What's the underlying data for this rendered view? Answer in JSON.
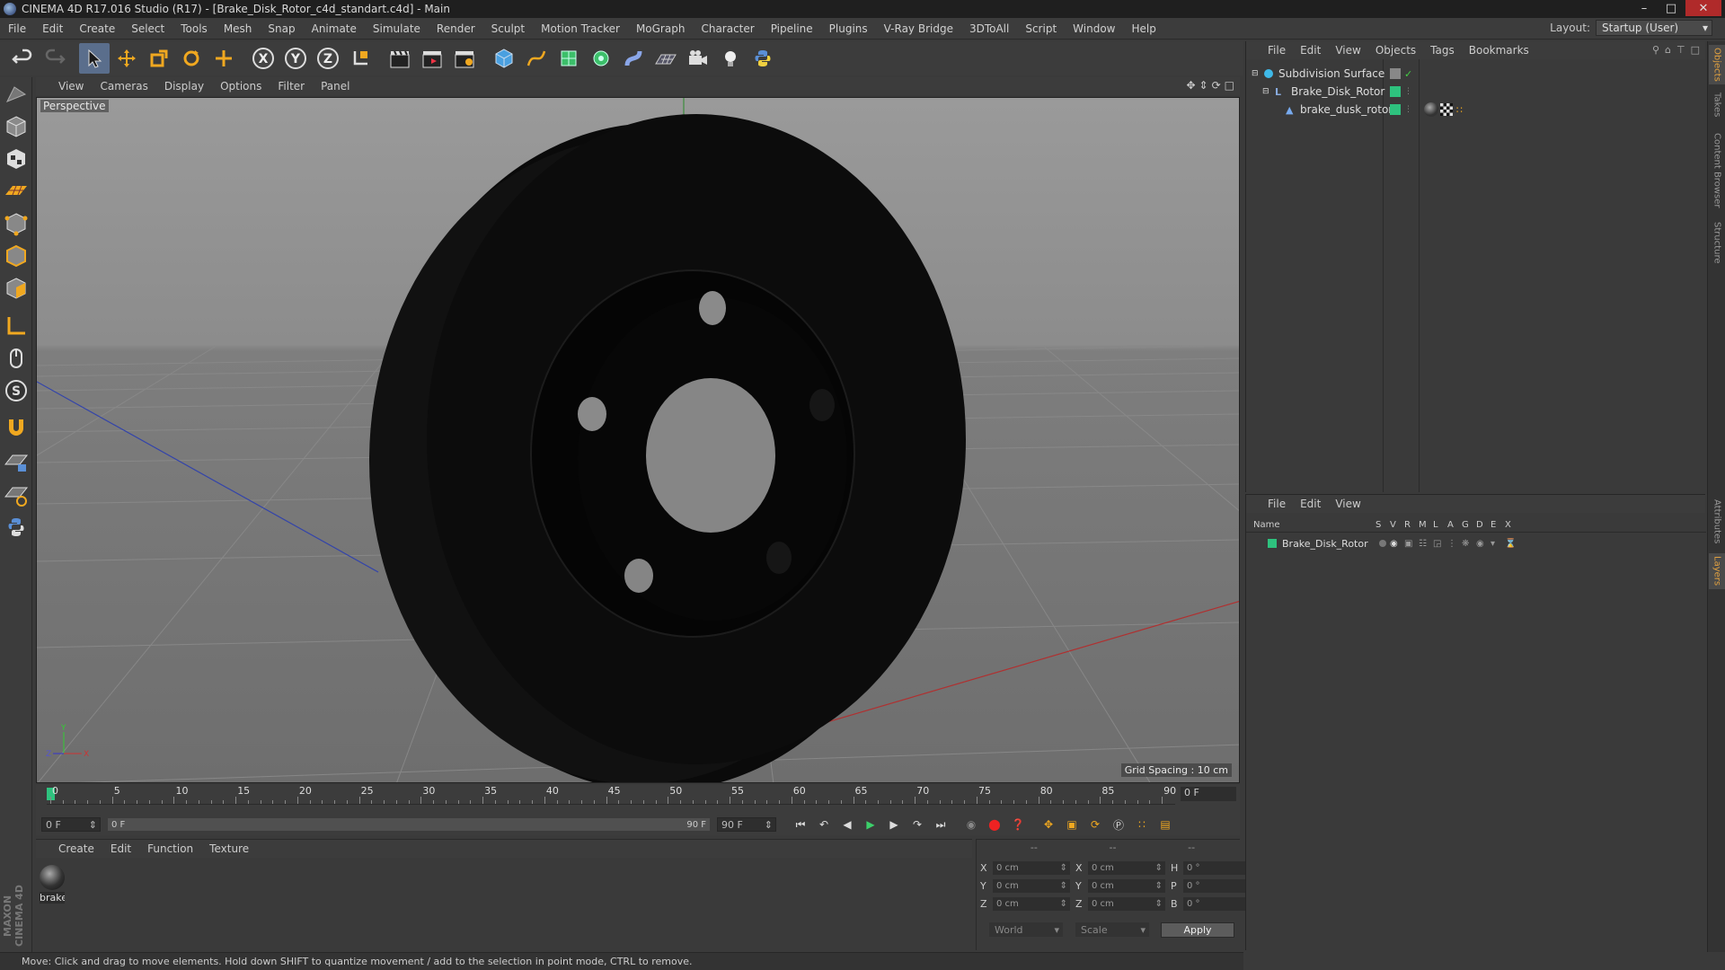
{
  "window": {
    "title": "CINEMA 4D R17.016 Studio (R17) - [Brake_Disk_Rotor_c4d_standart.c4d] - Main"
  },
  "menubar": {
    "items": [
      "File",
      "Edit",
      "Create",
      "Select",
      "Tools",
      "Mesh",
      "Snap",
      "Animate",
      "Simulate",
      "Render",
      "Sculpt",
      "Motion Tracker",
      "MoGraph",
      "Character",
      "Pipeline",
      "Plugins",
      "V-Ray Bridge",
      "3DToAll",
      "Script",
      "Window",
      "Help"
    ],
    "layout_label": "Layout:",
    "layout_value": "Startup (User)"
  },
  "toolbar": {
    "axis_x": "X",
    "axis_y": "Y",
    "axis_z": "Z"
  },
  "viewport": {
    "menu": [
      "View",
      "Cameras",
      "Display",
      "Options",
      "Filter",
      "Panel"
    ],
    "label": "Perspective",
    "grid_spacing": "Grid Spacing : 10 cm",
    "axis_y": "Y",
    "axis_x": "X",
    "axis_z": "Z"
  },
  "timeline": {
    "ticks": [
      "0",
      "5",
      "10",
      "15",
      "20",
      "25",
      "30",
      "35",
      "40",
      "45",
      "50",
      "55",
      "60",
      "65",
      "70",
      "75",
      "80",
      "85",
      "90"
    ],
    "current_frame": "0 F",
    "start_field": "0 F",
    "range_start": "0 F",
    "range_end": "90 F",
    "end_field": "90 F"
  },
  "material_manager": {
    "menu": [
      "Create",
      "Edit",
      "Function",
      "Texture"
    ],
    "material_name": "brake"
  },
  "coordinates": {
    "head": [
      "--",
      "--",
      "--"
    ],
    "rows": [
      {
        "a1": "X",
        "v1": "0 cm",
        "a2": "X",
        "v2": "0 cm",
        "a3": "H",
        "v3": "0 °"
      },
      {
        "a1": "Y",
        "v1": "0 cm",
        "a2": "Y",
        "v2": "0 cm",
        "a3": "P",
        "v3": "0 °"
      },
      {
        "a1": "Z",
        "v1": "0 cm",
        "a2": "Z",
        "v2": "0 cm",
        "a3": "B",
        "v3": "0 °"
      }
    ],
    "space_select": "World",
    "mode_select": "Scale",
    "apply_label": "Apply"
  },
  "status": {
    "text": "Move: Click and drag to move elements. Hold down SHIFT to quantize movement / add to the selection in point mode, CTRL to remove."
  },
  "object_manager": {
    "menu": [
      "File",
      "Edit",
      "View",
      "Objects",
      "Tags",
      "Bookmarks"
    ],
    "objects": [
      {
        "name": "Subdivision Surface"
      },
      {
        "name": "Brake_Disk_Rotor"
      },
      {
        "name": "brake_dusk_rotor"
      }
    ],
    "colors": {
      "layer": "#2ec27e",
      "subdiv_icon": "#3fb9e8"
    }
  },
  "layer_manager": {
    "menu": [
      "File",
      "Edit",
      "View"
    ],
    "columns": [
      "Name",
      "S",
      "V",
      "R",
      "M",
      "L",
      "A",
      "G",
      "D",
      "E",
      "X"
    ],
    "layers": [
      {
        "name": "Brake_Disk_Rotor"
      }
    ]
  },
  "right_tabs": [
    "Objects",
    "Takes",
    "Content Browser",
    "Structure",
    "Attributes",
    "Layers"
  ]
}
